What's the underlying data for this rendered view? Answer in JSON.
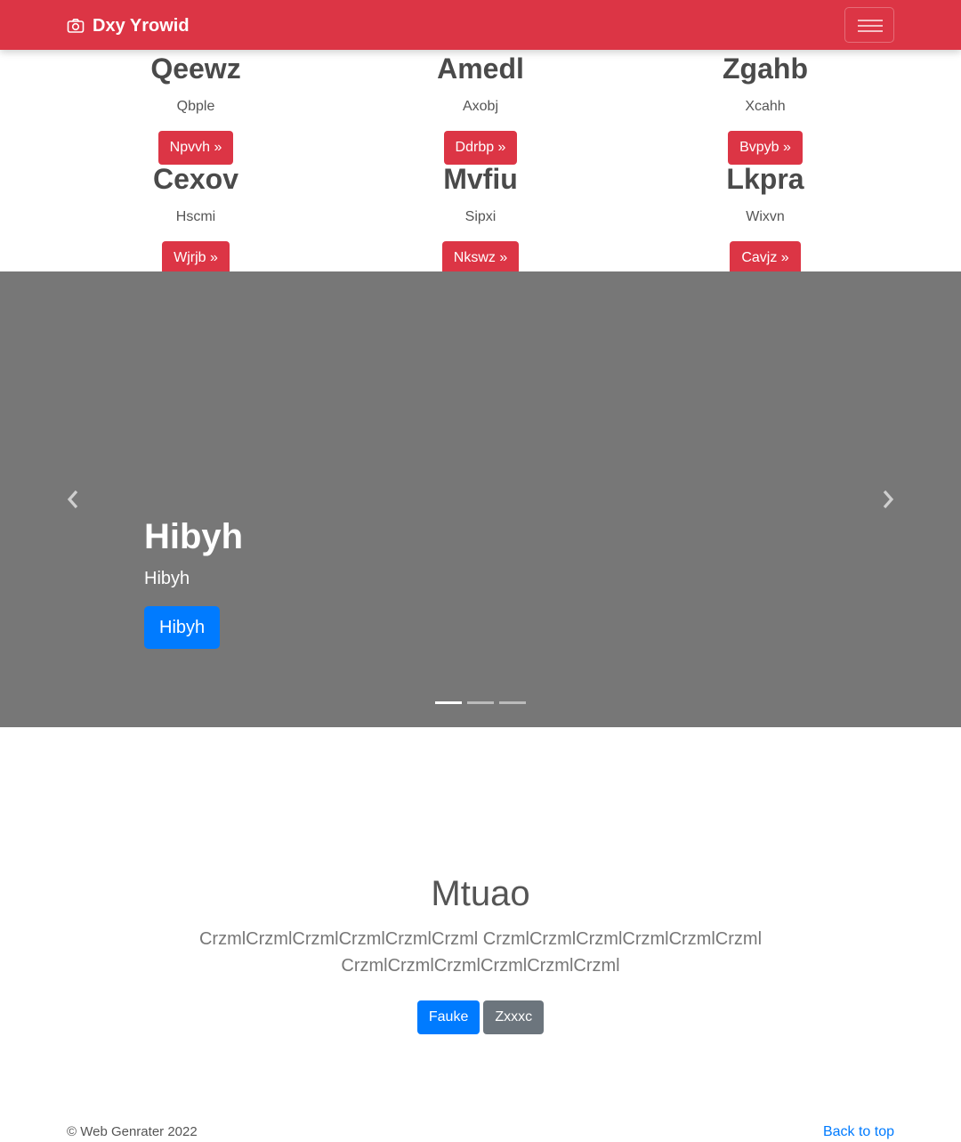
{
  "navbar": {
    "brand": "Dxy Yrowid",
    "brand_icon": "camera-icon",
    "toggler_icon": "hamburger-icon",
    "color": "#dc3545"
  },
  "features": [
    {
      "title": "Qeewz",
      "text": "Qbple",
      "button": "Npvvh »"
    },
    {
      "title": "Amedl",
      "text": "Axobj",
      "button": "Ddrbp »"
    },
    {
      "title": "Zgahb",
      "text": "Xcahh",
      "button": "Bvpyb »"
    },
    {
      "title": "Cexov",
      "text": "Hscmi",
      "button": "Wjrjb »"
    },
    {
      "title": "Mvfiu",
      "text": "Sipxi",
      "button": "Nkswz »"
    },
    {
      "title": "Lkpra",
      "text": "Wixvn",
      "button": "Cavjz »"
    }
  ],
  "carousel": {
    "heading": "Hibyh",
    "subheading": "Hibyh",
    "button": "Hibyh",
    "slides_total": 3,
    "active_slide": 1,
    "prev_icon": "chevron-left-icon",
    "next_icon": "chevron-right-icon",
    "background": "#777777"
  },
  "intro": {
    "title": "Mtuao",
    "lead": "CrzmlCrzmlCrzmlCrzmlCrzmlCrzml CrzmlCrzmlCrzmlCrzmlCrzmlCrzml CrzmlCrzmlCrzmlCrzmlCrzmlCrzml",
    "primary_button": "Fauke",
    "secondary_button": "Zxxxc"
  },
  "footer": {
    "copyright": "© Web Genrater 2022",
    "back_to_top": "Back to top"
  }
}
